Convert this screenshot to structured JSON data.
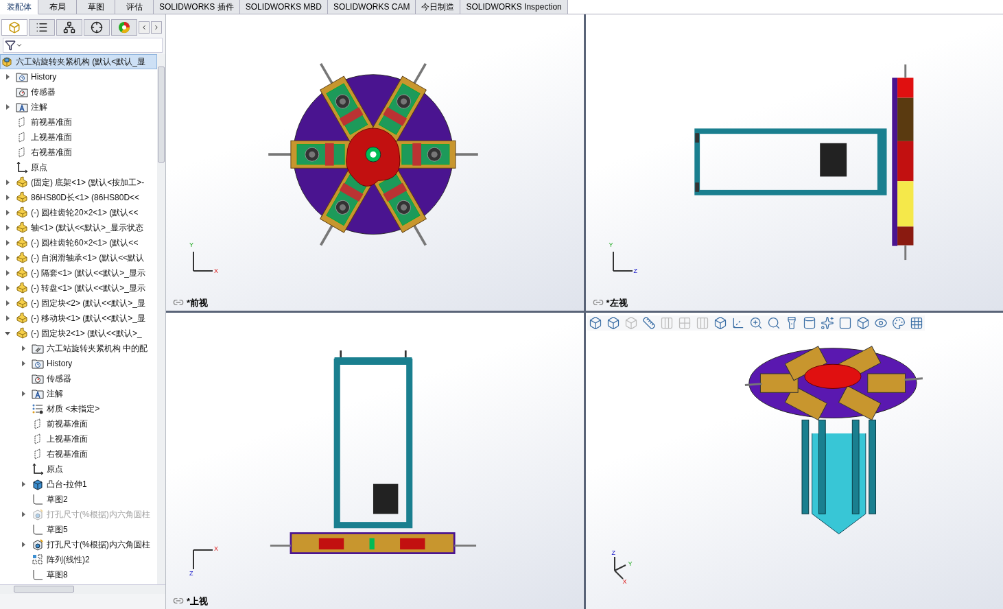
{
  "tabs": [
    {
      "label": "装配体",
      "selected": true
    },
    {
      "label": "布局",
      "selected": false
    },
    {
      "label": "草图",
      "selected": false
    },
    {
      "label": "评估",
      "selected": false
    },
    {
      "label": "SOLIDWORKS 插件",
      "selected": false
    },
    {
      "label": "SOLIDWORKS MBD",
      "selected": false
    },
    {
      "label": "SOLIDWORKS CAM",
      "selected": false
    },
    {
      "label": "今日制造",
      "selected": false
    },
    {
      "label": "SOLIDWORKS Inspection",
      "selected": false
    }
  ],
  "panel_tabs": [
    {
      "selected": true
    },
    {
      "selected": false
    },
    {
      "selected": false
    },
    {
      "selected": false
    },
    {
      "selected": false
    }
  ],
  "tree": {
    "items": [
      {
        "kind": "assembly",
        "label": "六工站旋转夹紧机构  (默认<默认_显",
        "selected": true,
        "disabled": false,
        "children": [
          {
            "kind": "history",
            "label": "History",
            "selected": false,
            "disabled": false,
            "expanded": false
          },
          {
            "kind": "sensor",
            "label": "传感器",
            "selected": false,
            "disabled": false
          },
          {
            "kind": "annotation",
            "label": "注解",
            "selected": false,
            "disabled": false,
            "expanded": false
          },
          {
            "kind": "plane",
            "label": "前视基准面",
            "selected": false,
            "disabled": false
          },
          {
            "kind": "plane",
            "label": "上视基准面",
            "selected": false,
            "disabled": false
          },
          {
            "kind": "plane",
            "label": "右视基准面",
            "selected": false,
            "disabled": false
          },
          {
            "kind": "origin",
            "label": "原点",
            "selected": false,
            "disabled": false
          },
          {
            "kind": "part",
            "label": "(固定) 底架<1> (默认<按加工>-",
            "selected": false,
            "disabled": false,
            "expanded": false
          },
          {
            "kind": "part",
            "label": "86HS80D长<1> (86HS80D<<",
            "selected": false,
            "disabled": false,
            "expanded": false
          },
          {
            "kind": "part",
            "label": "(-) 圆柱齿轮20×2<1> (默认<<",
            "selected": false,
            "disabled": false,
            "expanded": false
          },
          {
            "kind": "part",
            "label": "轴<1> (默认<<默认>_显示状态",
            "selected": false,
            "disabled": false,
            "expanded": false
          },
          {
            "kind": "part",
            "label": "(-) 圆柱齿轮60×2<1> (默认<<",
            "selected": false,
            "disabled": false,
            "expanded": false
          },
          {
            "kind": "part",
            "label": "(-) 自润滑轴承<1> (默认<<默认",
            "selected": false,
            "disabled": false,
            "expanded": false
          },
          {
            "kind": "part",
            "label": "(-) 隔套<1> (默认<<默认>_显示",
            "selected": false,
            "disabled": false,
            "expanded": false
          },
          {
            "kind": "part",
            "label": "(-) 转盘<1> (默认<<默认>_显示",
            "selected": false,
            "disabled": false,
            "expanded": false
          },
          {
            "kind": "part",
            "label": "(-) 固定块<2> (默认<<默认>_显",
            "selected": false,
            "disabled": false,
            "expanded": false
          },
          {
            "kind": "part",
            "label": "(-) 移动块<1> (默认<<默认>_显",
            "selected": false,
            "disabled": false,
            "expanded": false
          },
          {
            "kind": "part",
            "label": "(-) 固定块2<1> (默认<<默认>_",
            "selected": false,
            "disabled": false,
            "expanded": true,
            "children": [
              {
                "kind": "mates",
                "label": "六工站旋转夹紧机构 中的配",
                "selected": false,
                "disabled": false,
                "expanded": false
              },
              {
                "kind": "history",
                "label": "History",
                "selected": false,
                "disabled": false,
                "expanded": false
              },
              {
                "kind": "sensor",
                "label": "传感器",
                "selected": false,
                "disabled": false
              },
              {
                "kind": "annotation",
                "label": "注解",
                "selected": false,
                "disabled": false,
                "expanded": false
              },
              {
                "kind": "material",
                "label": "材质 <未指定>",
                "selected": false,
                "disabled": false
              },
              {
                "kind": "plane",
                "label": "前视基准面",
                "selected": false,
                "disabled": false
              },
              {
                "kind": "plane",
                "label": "上视基准面",
                "selected": false,
                "disabled": false
              },
              {
                "kind": "plane",
                "label": "右视基准面",
                "selected": false,
                "disabled": false
              },
              {
                "kind": "origin",
                "label": "原点",
                "selected": false,
                "disabled": false
              },
              {
                "kind": "extrude",
                "label": "凸台-拉伸1",
                "selected": false,
                "disabled": false,
                "expanded": false
              },
              {
                "kind": "sketch",
                "label": "草图2",
                "selected": false,
                "disabled": false
              },
              {
                "kind": "hole",
                "label": "打孔尺寸(%根据)内六角圆柱",
                "selected": false,
                "disabled": true,
                "expanded": false
              },
              {
                "kind": "sketch",
                "label": "草图5",
                "selected": false,
                "disabled": false
              },
              {
                "kind": "hole",
                "label": "打孔尺寸(%根据)内六角圆柱",
                "selected": false,
                "disabled": false,
                "expanded": false
              },
              {
                "kind": "pattern",
                "label": "阵列(线性)2",
                "selected": false,
                "disabled": false
              },
              {
                "kind": "sketch",
                "label": "草图8",
                "selected": false,
                "disabled": false
              }
            ]
          }
        ]
      }
    ]
  },
  "viewports": [
    {
      "kind": "front",
      "label": "*前视",
      "axes": [
        "Y",
        "X"
      ],
      "toolbar": false
    },
    {
      "kind": "left",
      "label": "*左视",
      "axes": [
        "Y",
        "Z"
      ],
      "toolbar": false
    },
    {
      "kind": "top",
      "label": "*上视",
      "axes": [
        "X",
        "Z"
      ],
      "toolbar": false
    },
    {
      "kind": "iso",
      "axes": [
        "Z",
        "Y",
        "X"
      ],
      "toolbar": true
    }
  ]
}
